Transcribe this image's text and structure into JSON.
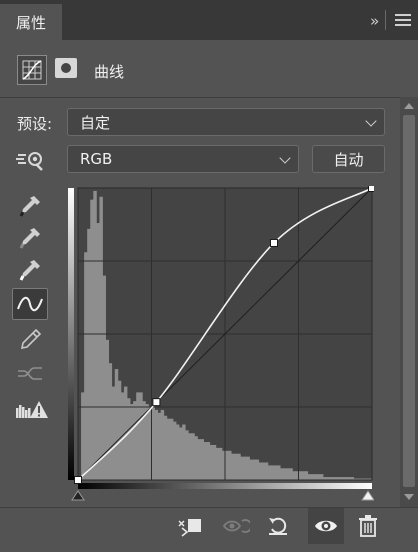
{
  "panel": {
    "tab_label": "属性",
    "collapse_label": "»",
    "title": "曲线"
  },
  "preset": {
    "label": "预设:",
    "value": "自定"
  },
  "channel": {
    "value": "RGB",
    "auto_label": "自动"
  },
  "tools": [
    "target-adjust-icon",
    "black-point-eyedropper-icon",
    "gray-point-eyedropper-icon",
    "white-point-eyedropper-icon",
    "curve-points-icon",
    "pencil-draw-icon",
    "smooth-curve-icon",
    "clipping-warning-icon"
  ],
  "chart_data": {
    "type": "line",
    "xlim": [
      0,
      255
    ],
    "ylim": [
      0,
      255
    ],
    "grid": "4x4",
    "series": [
      {
        "points": [
          [
            0,
            0
          ],
          [
            68,
            68
          ],
          [
            170,
            207
          ],
          [
            255,
            255
          ]
        ]
      }
    ],
    "histogram": [
      0,
      0.3,
      0.78,
      0.86,
      0.96,
      0.99,
      0.88,
      0.97,
      0.7,
      0.48,
      0.4,
      0.32,
      0.38,
      0.34,
      0.3,
      0.32,
      0.28,
      0.26,
      0.27,
      0.3,
      0.3,
      0.27,
      0.26,
      0.25,
      0.25,
      0.24,
      0.23,
      0.24,
      0.22,
      0.21,
      0.21,
      0.2,
      0.19,
      0.18,
      0.19,
      0.17,
      0.16,
      0.16,
      0.15,
      0.14,
      0.14,
      0.13,
      0.13,
      0.12,
      0.12,
      0.11,
      0.11,
      0.1,
      0.1,
      0.1,
      0.09,
      0.09,
      0.09,
      0.08,
      0.08,
      0.08,
      0.07,
      0.07,
      0.07,
      0.06,
      0.06,
      0.06,
      0.05,
      0.05,
      0.05,
      0.05,
      0.04,
      0.04,
      0.04,
      0.04,
      0.03,
      0.03,
      0.03,
      0.03,
      0.03,
      0.02,
      0.02,
      0.02,
      0.02,
      0.02,
      0.01,
      0.01,
      0.01,
      0.01,
      0.01,
      0.01,
      0.01,
      0.01,
      0.01,
      0.01,
      0.005,
      0.005,
      0.005,
      0.005,
      0.005,
      0.005
    ]
  },
  "bottom_icons": [
    "clip-to-layer-icon",
    "view-previous-state-icon",
    "reset-icon",
    "visibility-eye-icon",
    "delete-icon"
  ]
}
